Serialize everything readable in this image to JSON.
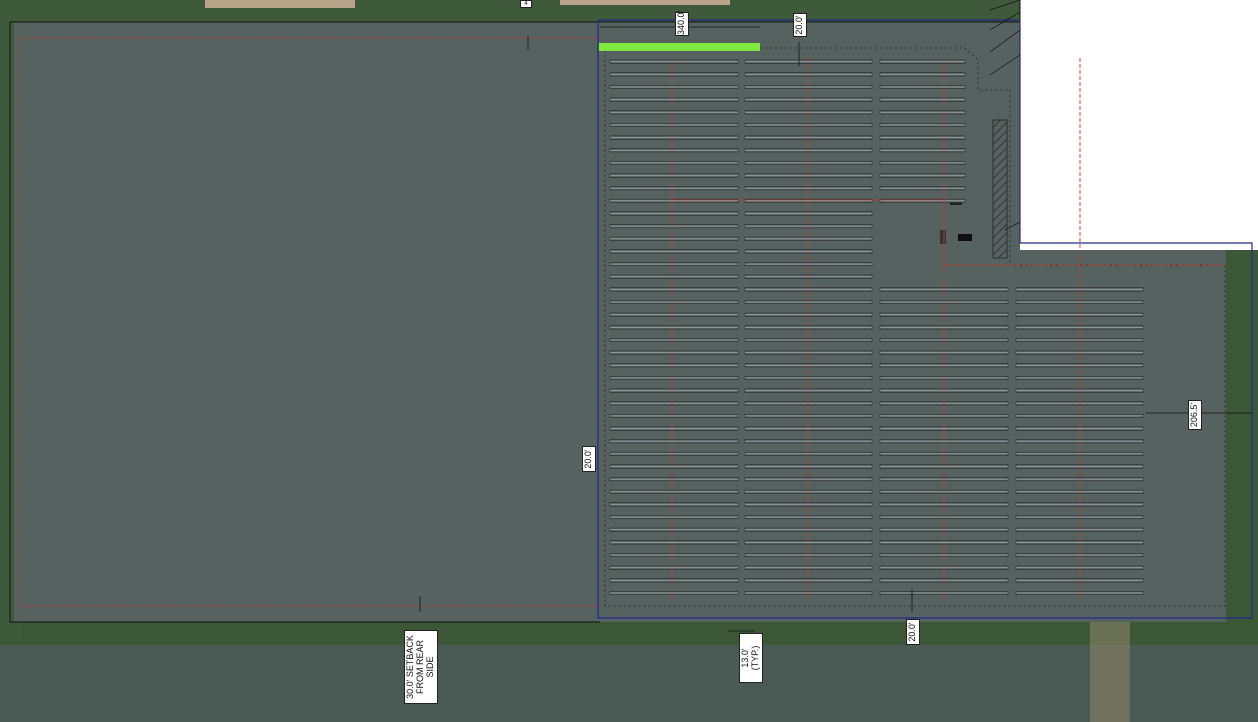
{
  "dimensions": {
    "top_width": "340.0'",
    "top_gap": "20.0'",
    "right_side": "206.5'",
    "left_gap": "20.0'",
    "bottom_gap": "20.0'",
    "row_spacing_line1": "13.0'",
    "row_spacing_line2": "(TYP.)",
    "setback_line1": "30.0' SETBACK",
    "setback_line2": "FROM REAR",
    "setback_line3": "SIDE",
    "top_cut": "4"
  },
  "colors": {
    "field": "#56625f",
    "tree_border": "#3f5a38",
    "parcel_line": "#1a1a1a",
    "setback_line": "#c0392b",
    "fence_line": "#1f2a8a",
    "highlight_bar": "#7ee83f",
    "panel_row": "#5e6a6c",
    "road": "#b9a58a"
  },
  "array": {
    "upper_rows": 12,
    "middle_rows": 6,
    "lower_rows": 26
  }
}
